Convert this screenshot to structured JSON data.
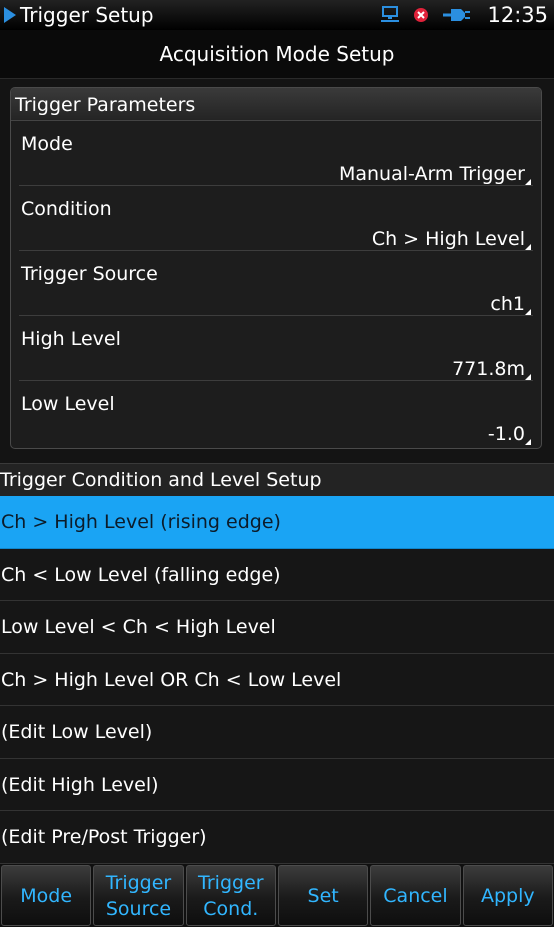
{
  "status_bar": {
    "app_title": "Trigger Setup",
    "clock": "12:35",
    "icons": [
      "network-icon",
      "alert-icon",
      "power-plug-icon"
    ]
  },
  "header": {
    "title": "Acquisition Mode Setup"
  },
  "trigger_parameters": {
    "title": "Trigger Parameters",
    "rows": [
      {
        "label": "Mode",
        "value": "Manual-Arm Trigger"
      },
      {
        "label": "Condition",
        "value": "Ch > High Level"
      },
      {
        "label": "Trigger Source",
        "value": "ch1"
      },
      {
        "label": "High Level",
        "value": "771.8m"
      },
      {
        "label": "Low Level",
        "value": "-1.0"
      }
    ]
  },
  "condition_setup": {
    "title": "Trigger Condition and Level Setup",
    "items": [
      "Ch > High Level (rising edge)",
      "Ch < Low Level (falling edge)",
      "Low Level < Ch < High Level",
      "Ch > High Level OR Ch < Low Level",
      "(Edit Low Level)",
      "(Edit High Level)",
      "(Edit Pre/Post Trigger)"
    ],
    "selected_index": 0
  },
  "softkeys": [
    {
      "line1": "Mode",
      "line2": ""
    },
    {
      "line1": "Trigger",
      "line2": "Source"
    },
    {
      "line1": "Trigger",
      "line2": "Cond."
    },
    {
      "line1": "Set",
      "line2": ""
    },
    {
      "line1": "Cancel",
      "line2": ""
    },
    {
      "line1": "Apply",
      "line2": ""
    }
  ],
  "colors": {
    "accent": "#1aa4f4",
    "softkey_text": "#31b6ff"
  }
}
